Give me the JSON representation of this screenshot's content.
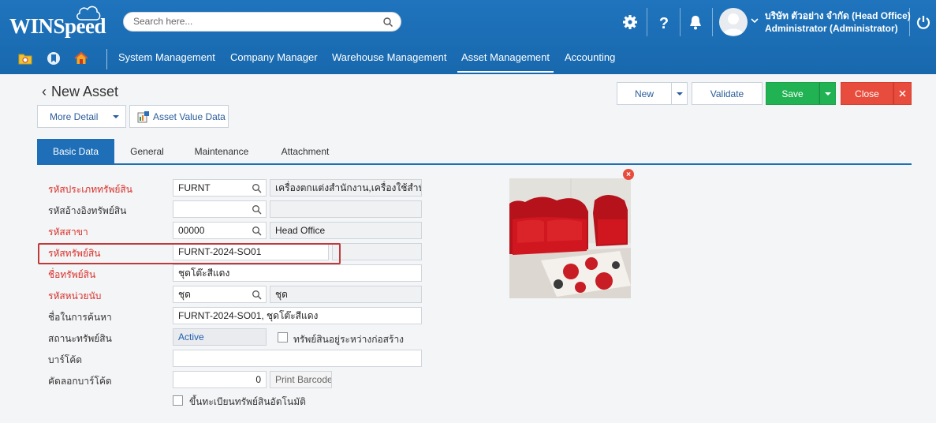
{
  "brand": {
    "name": "WINSpeed"
  },
  "search": {
    "placeholder": "Search here..."
  },
  "user": {
    "company": "บริษัท ตัวอย่าง จำกัด (Head Office)",
    "name": "Administrator (Administrator)"
  },
  "nav": {
    "menus": [
      "System Management",
      "Company Manager",
      "Warehouse Management",
      "Asset Management",
      "Accounting"
    ],
    "active": "Asset Management"
  },
  "page": {
    "title": "New Asset",
    "more_detail": "More Detail",
    "asset_value_data": "Asset Value Data"
  },
  "actions": {
    "new": "New",
    "validate": "Validate",
    "save": "Save",
    "close": "Close"
  },
  "tabs": [
    "Basic Data",
    "General",
    "Maintenance",
    "Attachment"
  ],
  "form": {
    "asset_type_code": {
      "label": "รหัสประเภททรัพย์สิน",
      "value": "FURNT",
      "desc": "เครื่องตกแต่งสำนักงาน,เครื่องใช้สำนั"
    },
    "ref_asset_code": {
      "label": "รหัสอ้างอิงทรัพย์สิน",
      "value": "",
      "desc": ""
    },
    "branch_code": {
      "label": "รหัสสาขา",
      "value": "00000",
      "desc": "Head Office"
    },
    "asset_code": {
      "label": "รหัสทรัพย์สิน",
      "value": "FURNT-2024-SO01"
    },
    "asset_name": {
      "label": "ชื่อทรัพย์สิน",
      "value": "ชุดโต๊ะสีแดง"
    },
    "unit_code": {
      "label": "รหัสหน่วยนับ",
      "value": "ชุด",
      "desc": "ชุด"
    },
    "search_name": {
      "label": "ชื่อในการค้นหา",
      "value": "FURNT-2024-SO01, ชุดโต๊ะสีแดง"
    },
    "asset_status": {
      "label": "สถานะทรัพย์สิน",
      "value": "Active"
    },
    "under_construction": {
      "label": "ทรัพย์สินอยู่ระหว่างก่อสร้าง"
    },
    "barcode": {
      "label": "บาร์โค้ด",
      "value": ""
    },
    "copy_barcode": {
      "label": "คัดลอกบาร์โค้ด",
      "value": "0",
      "button": "Print Barcode"
    },
    "auto_register": {
      "label": "ขึ้นทะเบียนทรัพย์สินอัตโนมัติ"
    }
  },
  "colors": {
    "header": "#1f74bd",
    "tab_active": "#1e6fb7",
    "save": "#21b353",
    "close": "#e74c3c",
    "required_label": "#d8312a"
  }
}
